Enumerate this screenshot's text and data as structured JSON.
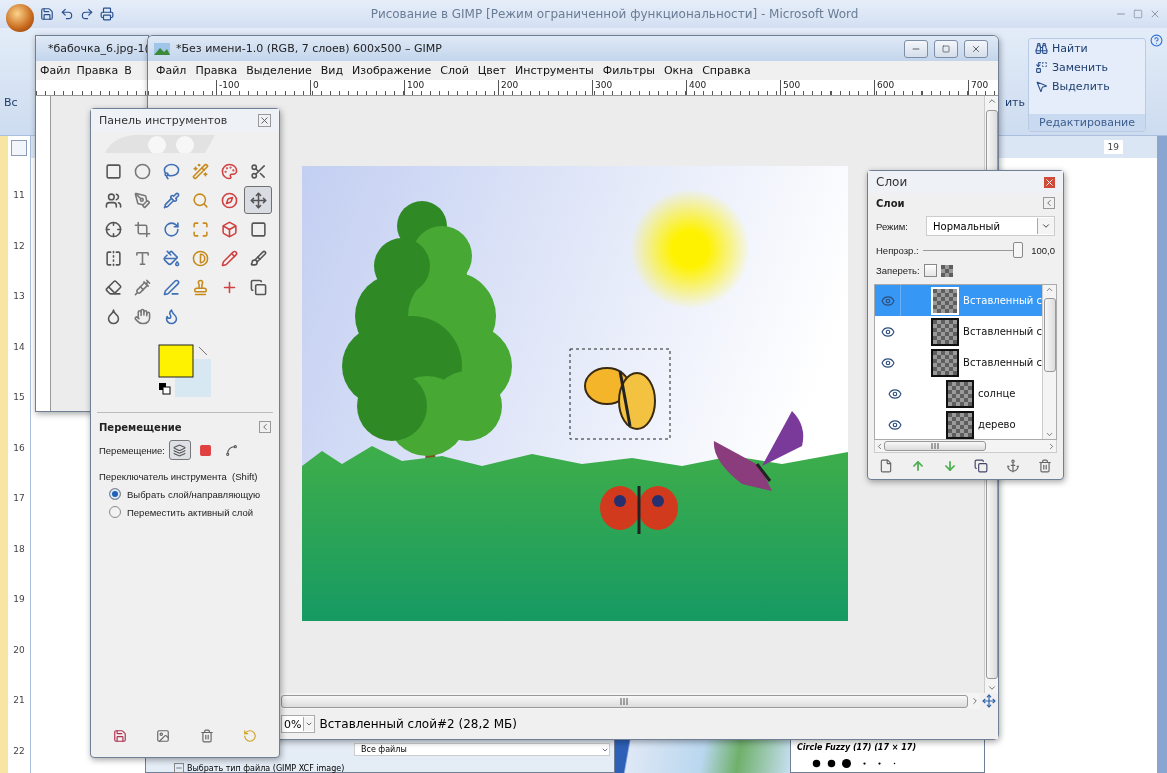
{
  "word": {
    "title": "Рисование в GIMP [Режим ограниченной функциональности] - Microsoft Word",
    "ribbon_left": "Вс",
    "ribbon_fragment": "ить",
    "editing_group": {
      "items": [
        "Найти",
        "Заменить",
        "Выделить"
      ],
      "label": "Редактирование"
    },
    "ruler_number": "19",
    "vertical_ruler": [
      "11",
      "12",
      "13",
      "14",
      "15",
      "16",
      "17",
      "18",
      "19",
      "20",
      "21",
      "22"
    ]
  },
  "back_window": {
    "title": "*бабочка_6.jpg-1(",
    "menu": [
      "Файл",
      "Правка",
      "В"
    ]
  },
  "gimp_window": {
    "title": "*Без имени-1.0 (RGB, 7 слоев) 600x500 – GIMP",
    "menu": [
      "Файл",
      "Правка",
      "Выделение",
      "Вид",
      "Изображение",
      "Слой",
      "Цвет",
      "Инструменты",
      "Фильтры",
      "Окна",
      "Справка"
    ],
    "ruler": [
      "-100",
      "0",
      "100",
      "200",
      "300",
      "400",
      "500",
      "600",
      "700"
    ],
    "status": {
      "zoom": "0%",
      "layer_info": "Вставленный слой#2 (28,2 МБ)"
    }
  },
  "toolbox": {
    "title": "Панель инструментов",
    "tools": [
      {
        "selected": false
      },
      {
        "selected": false
      },
      {
        "selected": false
      },
      {
        "selected": false
      },
      {
        "selected": false
      },
      {
        "selected": false
      },
      {
        "selected": false
      },
      {
        "selected": false
      },
      {
        "selected": false
      },
      {
        "selected": false
      },
      {
        "selected": false
      },
      {
        "selected": true
      },
      {
        "selected": false
      },
      {
        "selected": false
      },
      {
        "selected": false
      },
      {
        "selected": false
      },
      {
        "selected": false
      },
      {
        "selected": false
      },
      {
        "selected": false
      },
      {
        "selected": false
      },
      {
        "selected": false
      },
      {
        "selected": false
      },
      {
        "selected": false
      },
      {
        "selected": false
      },
      {
        "selected": false
      },
      {
        "selected": false
      },
      {
        "selected": false
      },
      {
        "selected": false
      },
      {
        "selected": false
      },
      {
        "selected": false
      },
      {
        "selected": false
      },
      {
        "selected": false
      },
      {
        "selected": false
      }
    ],
    "options": {
      "title": "Перемещение",
      "mode_label": "Перемещение:",
      "modes": [
        {
          "selected": true
        },
        {
          "selected": false
        },
        {
          "selected": false
        }
      ],
      "switch_label": "Переключатель инструмента  (Shift)",
      "choices": [
        {
          "label": "Выбрать слой/направляющую",
          "selected": true
        },
        {
          "label": "Переместить активный слой",
          "selected": false
        }
      ]
    }
  },
  "layers": {
    "title": "Слои",
    "section": "Слои",
    "mode_label": "Режим:",
    "mode": "Нормальный",
    "opacity_label": "Непрозр.:",
    "opacity": {
      "level": 1
    },
    "opacity_value": "100,0",
    "lock_label": "Запереть:",
    "lock_pixels": {
      "checked": false
    },
    "items": [
      {
        "name": "Вставленный с",
        "visible": true,
        "selected": true
      },
      {
        "name": "Вставленный с",
        "visible": true,
        "selected": false
      },
      {
        "name": "Вставленный с",
        "visible": true,
        "selected": false
      },
      {
        "name": "солнце",
        "visible": true,
        "selected": false
      },
      {
        "name": "дерево",
        "visible": true,
        "selected": false
      }
    ]
  },
  "file_dialog": {
    "filter": "Все файлы",
    "type_label": "Выбрать тип файла (GIMP XCF image)"
  },
  "brushes": {
    "title": "Circle Fuzzy (17) (17 × 17)"
  }
}
